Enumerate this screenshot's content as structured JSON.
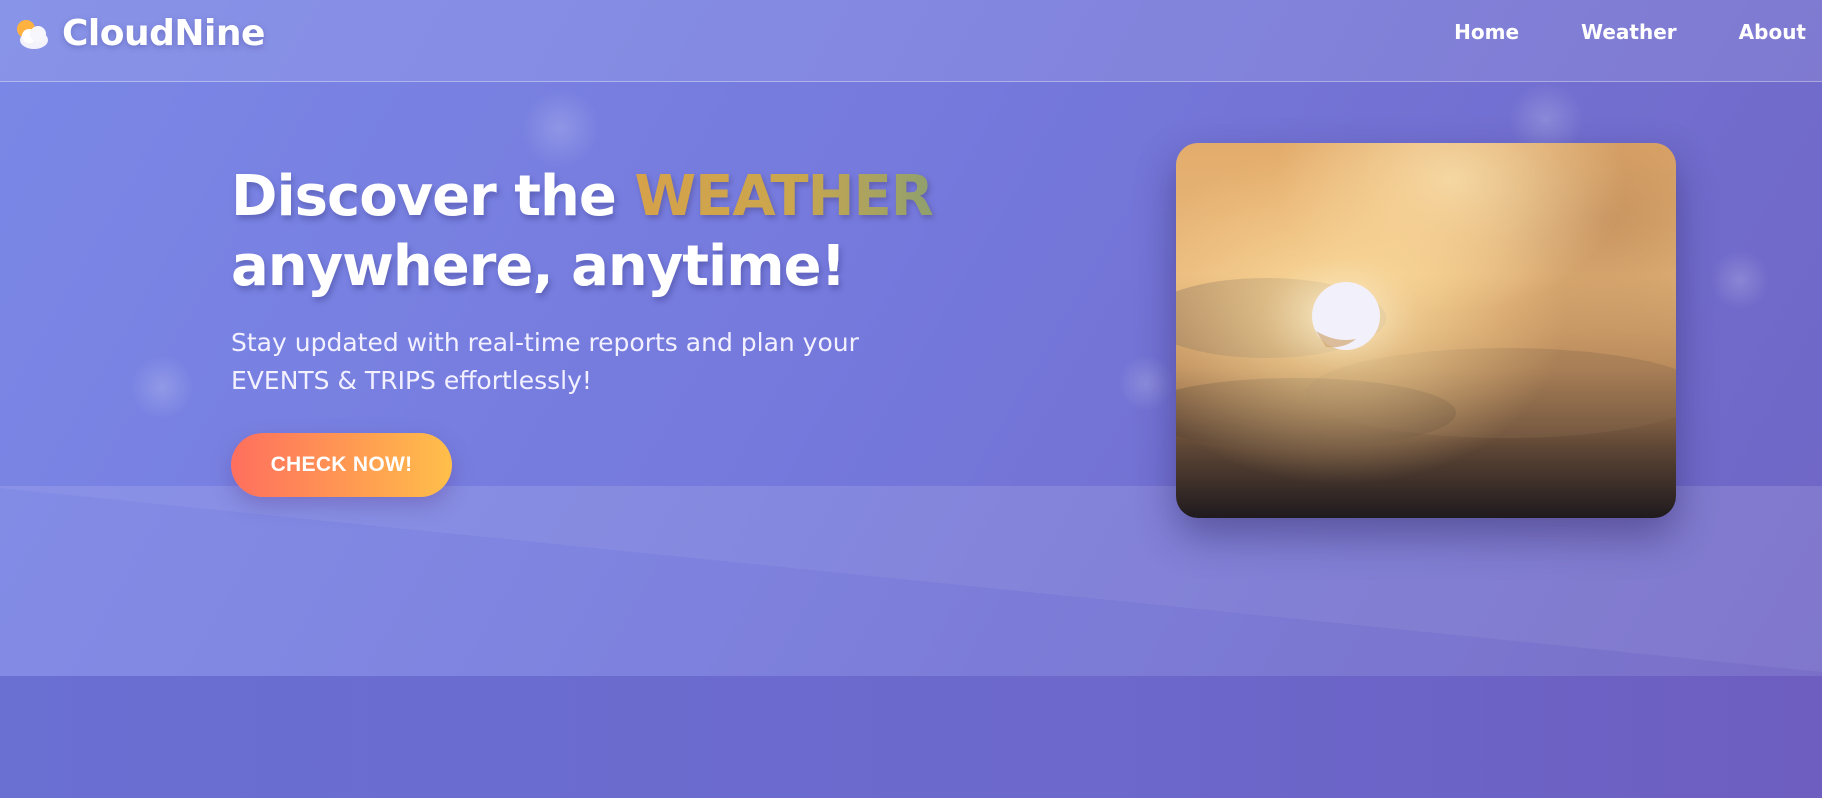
{
  "brand": {
    "name": "CloudNine",
    "icon": "partly-cloudy-icon"
  },
  "nav": {
    "items": [
      {
        "label": "Home"
      },
      {
        "label": "Weather"
      },
      {
        "label": "About"
      }
    ]
  },
  "hero": {
    "title_prefix": "Discover the ",
    "title_accent": "WEATHER",
    "title_line2": "anywhere, anytime!",
    "subtitle_line1": "Stay updated with real-time reports and plan your",
    "subtitle_line2": "EVENTS & TRIPS effortlessly!",
    "cta_label": "CHECK NOW!"
  },
  "colors": {
    "background_start": "#7b88e6",
    "background_end": "#6f64c3",
    "accent_gold": "#d6a24a",
    "cta_start": "#ff6f5e",
    "cta_end": "#ffbf4a",
    "text": "#ffffff"
  },
  "image": {
    "subject": "sun-behind-clouds-photo"
  }
}
